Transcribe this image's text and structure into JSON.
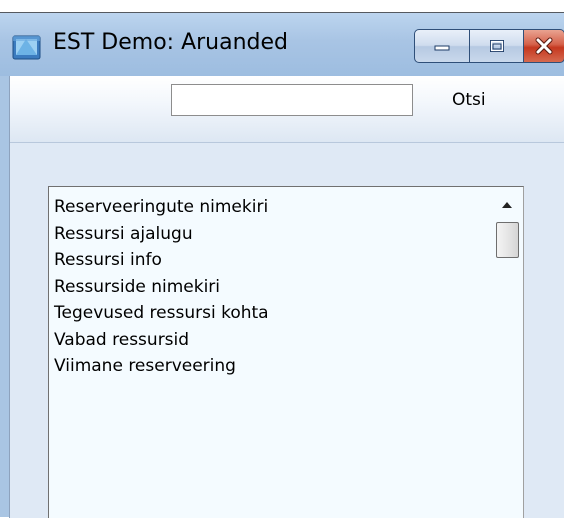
{
  "window": {
    "title": "EST Demo: Aruanded",
    "icon": "app-folder-icon",
    "controls": {
      "minimize_icon": "minimize-icon",
      "maximize_icon": "maximize-icon",
      "close_icon": "close-icon"
    }
  },
  "search": {
    "value": "",
    "placeholder": "",
    "button_label": "Otsi"
  },
  "reports": [
    "Reserveeringute nimekiri",
    "Ressursi ajalugu",
    "Ressursi info",
    "Ressurside nimekiri",
    "Tegevused ressursi kohta",
    "Vabad ressursid",
    "Viimane reserveering"
  ],
  "colors": {
    "titlebar": "#a8c4e4",
    "client": "#dfe9f5",
    "list_background": "#f4fbff",
    "close_button": "#c5381f"
  }
}
